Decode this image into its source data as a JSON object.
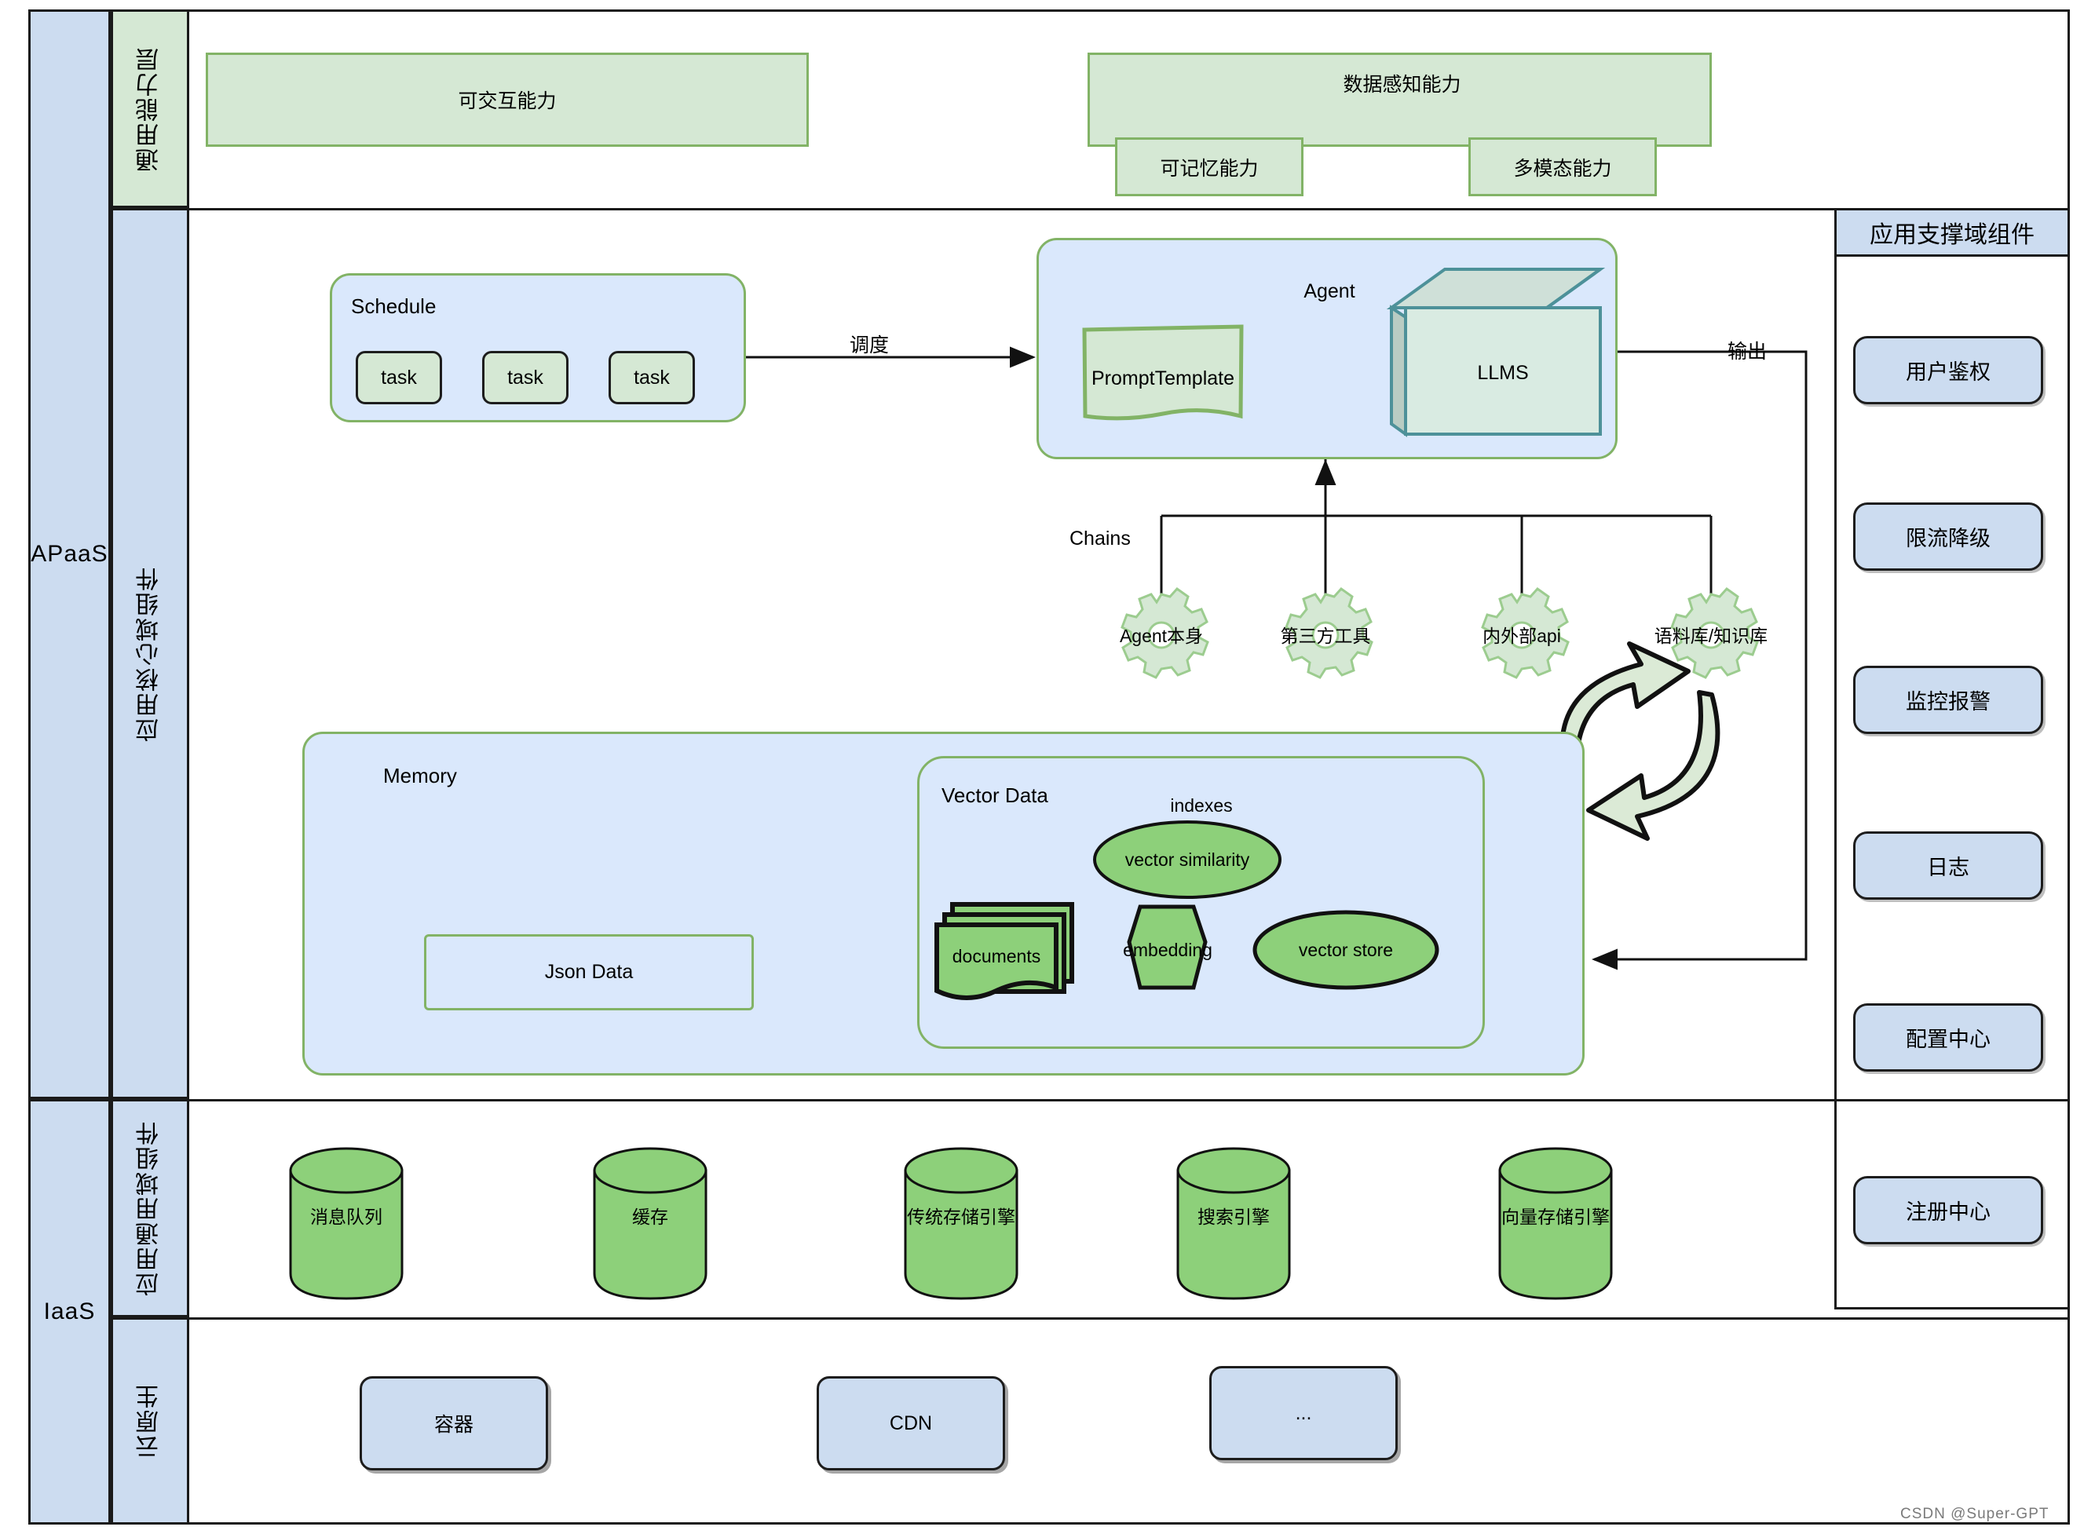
{
  "left_rail": {
    "apaas": "APaaS",
    "iaas": "IaaS",
    "layers": {
      "general_ability": "通用能力层",
      "app_core_domain": "应用核心域组件",
      "app_common_domain": "应用通用域组件",
      "cloud_native": "云原生"
    }
  },
  "general_ability_layer": {
    "interactive": "可交互能力",
    "data_perception": "数据感知能力",
    "memorable": "可记忆能力",
    "multimodal": "多模态能力"
  },
  "core": {
    "schedule": {
      "title": "Schedule",
      "tasks": [
        "task",
        "task",
        "task"
      ]
    },
    "arrow_schedule_to_agent": "调度",
    "agent": {
      "title": "Agent",
      "prompt_template": "PromptTemplate",
      "llms": "LLMS"
    },
    "arrow_output": "输出",
    "chains": {
      "title": "Chains",
      "items": [
        "Agent本身",
        "第三方工具",
        "内外部api",
        "语料库/知识库"
      ]
    },
    "memory": {
      "title": "Memory",
      "json_data": "Json Data",
      "vector_data": {
        "title": "Vector Data",
        "indexes": "indexes",
        "vector_similarity": "vector similarity",
        "documents": "documents",
        "embedding": "embedding",
        "vector_store": "vector store"
      }
    }
  },
  "support_domain": {
    "title": "应用支撑域组件",
    "items": [
      "用户鉴权",
      "限流降级",
      "监控报警",
      "日志",
      "配置中心"
    ],
    "registry": "注册中心"
  },
  "common_domain": {
    "stores": [
      "消息队列",
      "缓存",
      "传统存储引擎",
      "搜索引擎",
      "向量存储引擎"
    ]
  },
  "cloud_native": {
    "items": [
      "容器",
      "CDN",
      "..."
    ]
  },
  "watermark": "CSDN @Super-GPT",
  "colors": {
    "green_fill": "#d5e8d4",
    "green_stroke": "#82b366",
    "blue_fill": "#dae8fc",
    "blue_rail": "#ccdcf0",
    "dark_stroke": "#1a1a1a",
    "cylinder_green": "#8dd07a"
  }
}
